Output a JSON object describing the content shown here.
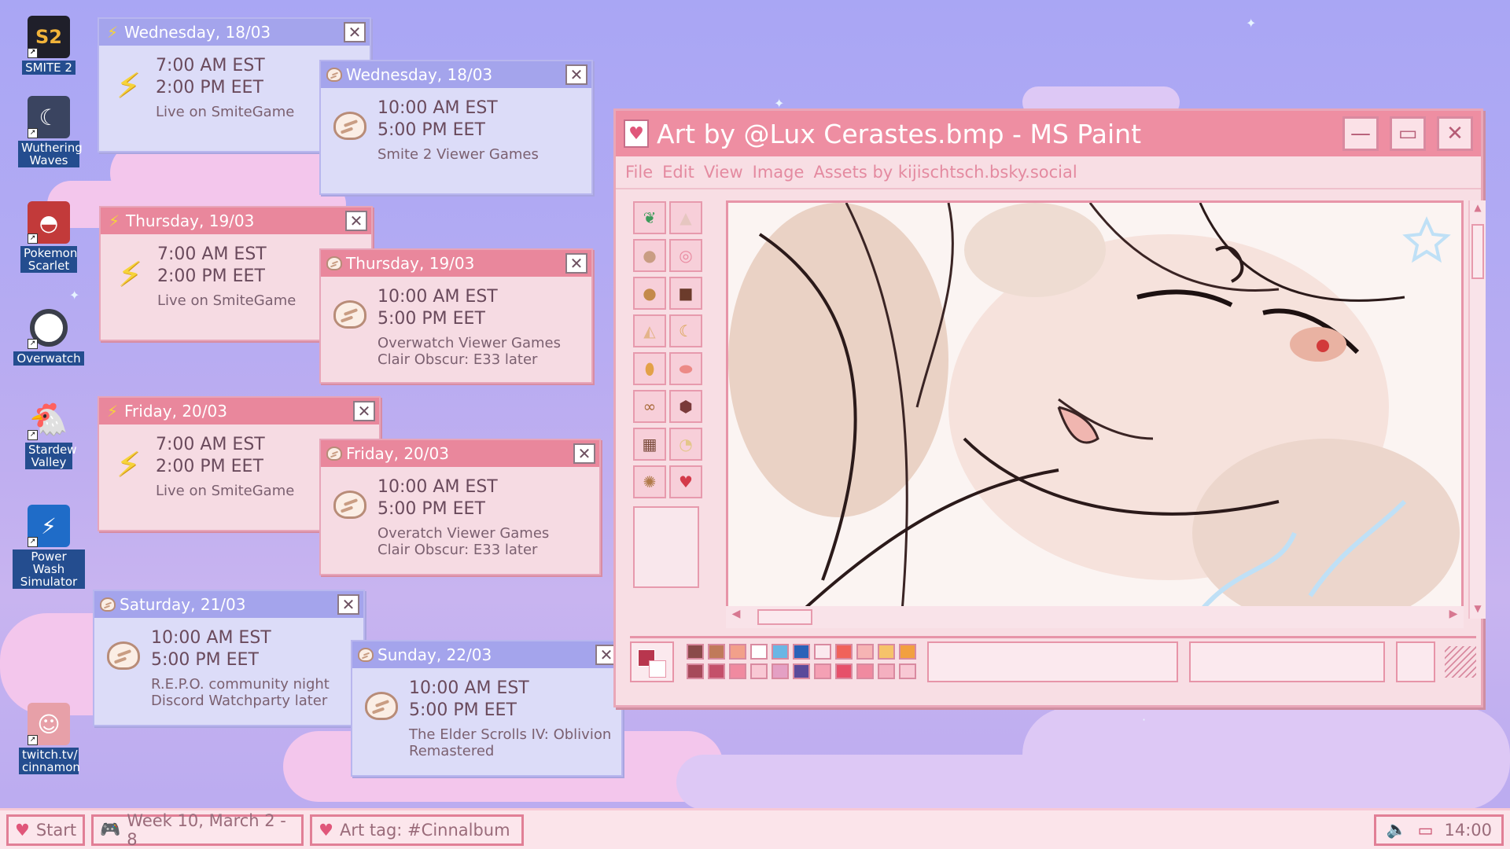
{
  "desktop_icons": [
    {
      "label": "SMITE 2",
      "icon": "smite-icon",
      "color": "#1f1f2a"
    },
    {
      "label": "Wuthering Waves",
      "icon": "wuthering-waves-icon",
      "color": "#3a4460"
    },
    {
      "label": "Pokemon Scarlet",
      "icon": "pokemon-scarlet-icon",
      "color": "#c23a3a"
    },
    {
      "label": "Overwatch",
      "icon": "overwatch-icon",
      "color": "#3b3f4b"
    },
    {
      "label": "Stardew Valley",
      "icon": "stardew-valley-icon",
      "color": "#d89a4a"
    },
    {
      "label": "Power Wash Simulator",
      "icon": "power-wash-icon",
      "color": "#1f6cc8"
    },
    {
      "label": "twitch.tv/ cinnamon",
      "icon": "twitch-avatar-icon",
      "color": "#e7a0a8"
    }
  ],
  "schedule": {
    "wed_smite": {
      "title": "Wednesday, 18/03",
      "t1": "7:00 AM EST",
      "t2": "2:00 PM EET",
      "n1": "Live on SmiteGame",
      "n2": ""
    },
    "wed_cin": {
      "title": "Wednesday, 18/03",
      "t1": "10:00 AM EST",
      "t2": "5:00 PM EET",
      "n1": "Smite 2 Viewer Games",
      "n2": ""
    },
    "thu_smite": {
      "title": "Thursday, 19/03",
      "t1": "7:00 AM EST",
      "t2": "2:00 PM EET",
      "n1": "Live on SmiteGame",
      "n2": ""
    },
    "thu_cin": {
      "title": "Thursday, 19/03",
      "t1": "10:00 AM EST",
      "t2": "5:00 PM EET",
      "n1": "Overwatch Viewer Games",
      "n2": "Clair Obscur: E33 later"
    },
    "fri_smite": {
      "title": "Friday, 20/03",
      "t1": "7:00 AM EST",
      "t2": "2:00 PM EET",
      "n1": "Live on SmiteGame",
      "n2": ""
    },
    "fri_cin": {
      "title": "Friday, 20/03",
      "t1": "10:00 AM EST",
      "t2": "5:00 PM EET",
      "n1": "Overatch Viewer Games",
      "n2": "Clair Obscur: E33 later"
    },
    "sat": {
      "title": "Saturday, 21/03",
      "t1": "10:00 AM EST",
      "t2": "5:00 PM EET",
      "n1": "R.E.P.O. community night",
      "n2": "Discord Watchparty later"
    },
    "sun": {
      "title": "Sunday, 22/03",
      "t1": "10:00 AM EST",
      "t2": "5:00 PM EET",
      "n1": "The Elder Scrolls IV: Oblivion",
      "n2": "Remastered"
    }
  },
  "paint": {
    "title": "Art by @Lux Cerastes.bmp - MS Paint",
    "menu": [
      "File",
      "Edit",
      "View",
      "Image",
      "Assets by kijischtsch.bsky.social"
    ],
    "min": "—",
    "max": "▭",
    "close": "✕"
  },
  "taskbar": {
    "start": "Start",
    "week": "Week 10, March 2 - 8",
    "art_tag": "Art tag: #Cinnalbum",
    "clock": "14:00"
  },
  "colors": {
    "accent_pink": "#e9879c",
    "accent_blue": "#a4a4ec",
    "bolt_yellow": "#f6d33a"
  }
}
